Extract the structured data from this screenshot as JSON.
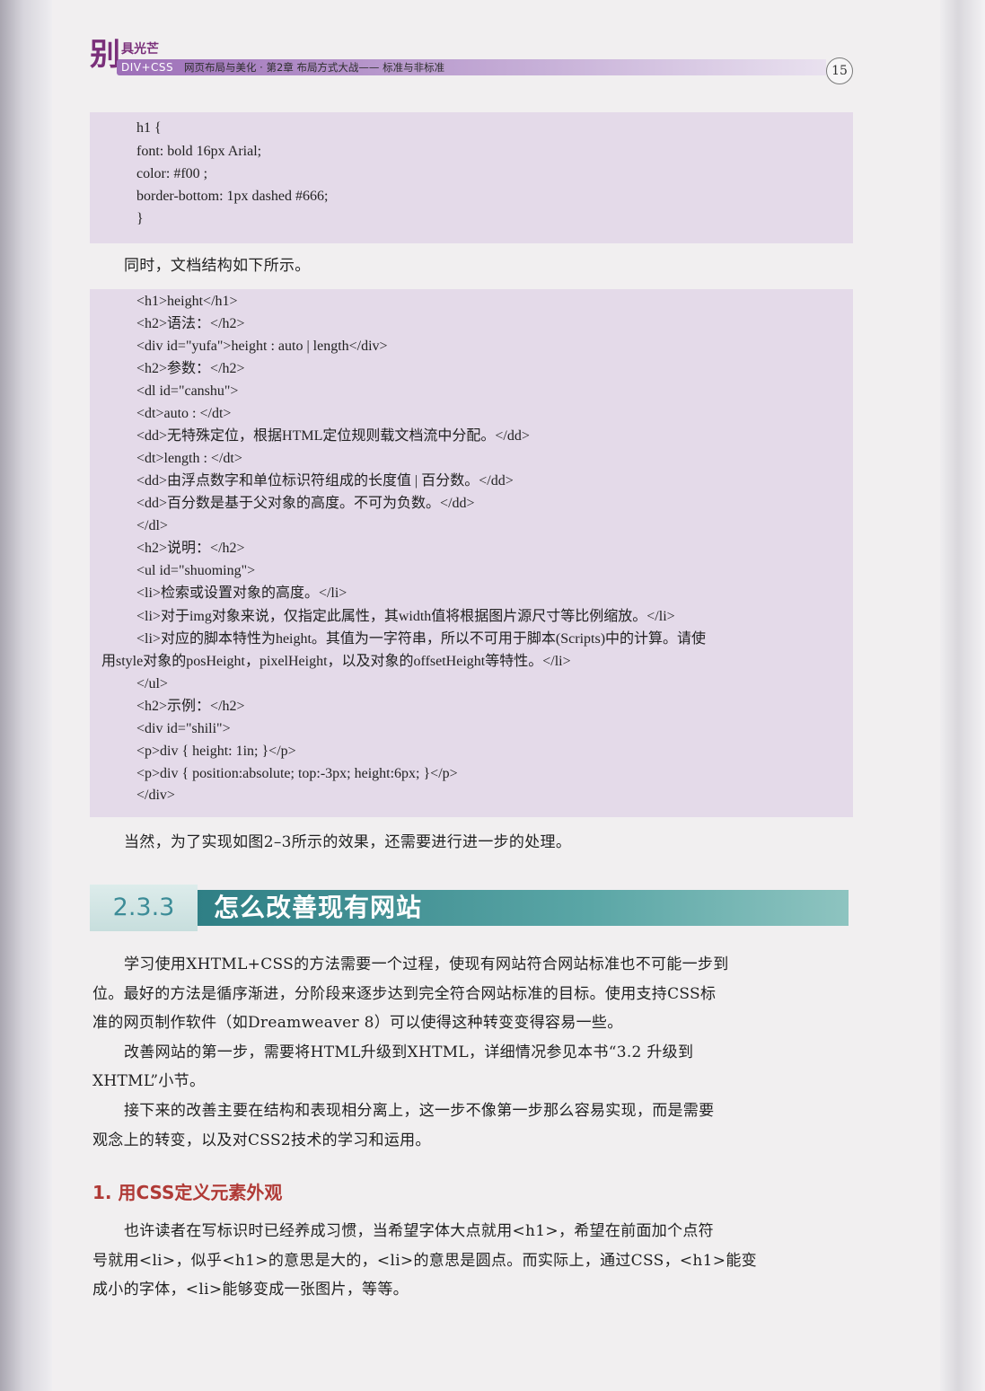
{
  "header": {
    "logo_char": "别",
    "logo_sub": "具光芒",
    "book": "DIV+CSS",
    "chapter": "网页布局与美化 · 第2章   布局方式大战—— 标准与非标准",
    "page_number": "15"
  },
  "code_block_1": [
    "h1 {",
    "font: bold 16px Arial;",
    "color: #f00 ;",
    "border-bottom: 1px dashed #666;",
    "}"
  ],
  "intro_line": "同时，文档结构如下所示。",
  "code_block_2": [
    "<h1>height</h1>",
    "<h2>语法：</h2>",
    "<div id=\"yufa\">height : auto | length</div>",
    "<h2>参数：</h2>",
    "<dl id=\"canshu\">",
    "<dt>auto : </dt>",
    "<dd>无特殊定位，根据HTML定位规则载文档流中分配。</dd>",
    "<dt>length : </dt>",
    "<dd>由浮点数字和单位标识符组成的长度值 | 百分数。</dd>",
    "<dd>百分数是基于父对象的高度。不可为负数。</dd>",
    "</dl>",
    "<h2>说明：</h2>",
    "<ul id=\"shuoming\">",
    "<li>检索或设置对象的高度。</li>",
    "<li>对于img对象来说，仅指定此属性，其width值将根据图片源尺寸等比例缩放。</li>",
    "<li>对应的脚本特性为height。其值为一字符串，所以不可用于脚本(Scripts)中的计算。请使",
    "用style对象的posHeight，pixelHeight，以及对象的offsetHeight等特性。</li>",
    "</ul>",
    "<h2>示例：</h2>",
    "<div id=\"shili\">",
    "<p>div { height: 1in; }</p>",
    "<p>div { position:absolute; top:-3px; height:6px; }</p>",
    "</div>"
  ],
  "after_code": "当然，为了实现如图2–3所示的效果，还需要进行进一步的处理。",
  "section": {
    "number": "2.3.3",
    "title": "怎么改善现有网站"
  },
  "body_lines": [
    "学习使用XHTML+CSS的方法需要一个过程，使现有网站符合网站标准也不可能一步到",
    "位。最好的方法是循序渐进，分阶段来逐步达到完全符合网站标准的目标。使用支持CSS标",
    "准的网页制作软件（如Dreamweaver 8）可以使得这种转变变得容易一些。",
    "改善网站的第一步，需要将HTML升级到XHTML，详细情况参见本书“3.2 升级到",
    "XHTML”小节。",
    "接下来的改善主要在结构和表现相分离上，这一步不像第一步那么容易实现，而是需要",
    "观念上的转变，以及对CSS2技术的学习和运用。"
  ],
  "subsection_title": "1. 用CSS定义元素外观",
  "sub_lines": [
    "也许读者在写标识时已经养成习惯，当希望字体大点就用<h1>，希望在前面加个点符",
    "号就用<li>，似乎<h1>的意思是大的，<li>的意思是圆点。而实际上，通过CSS，<h1>能变",
    "成小的字体，<li>能够变成一张图片，等等。"
  ]
}
